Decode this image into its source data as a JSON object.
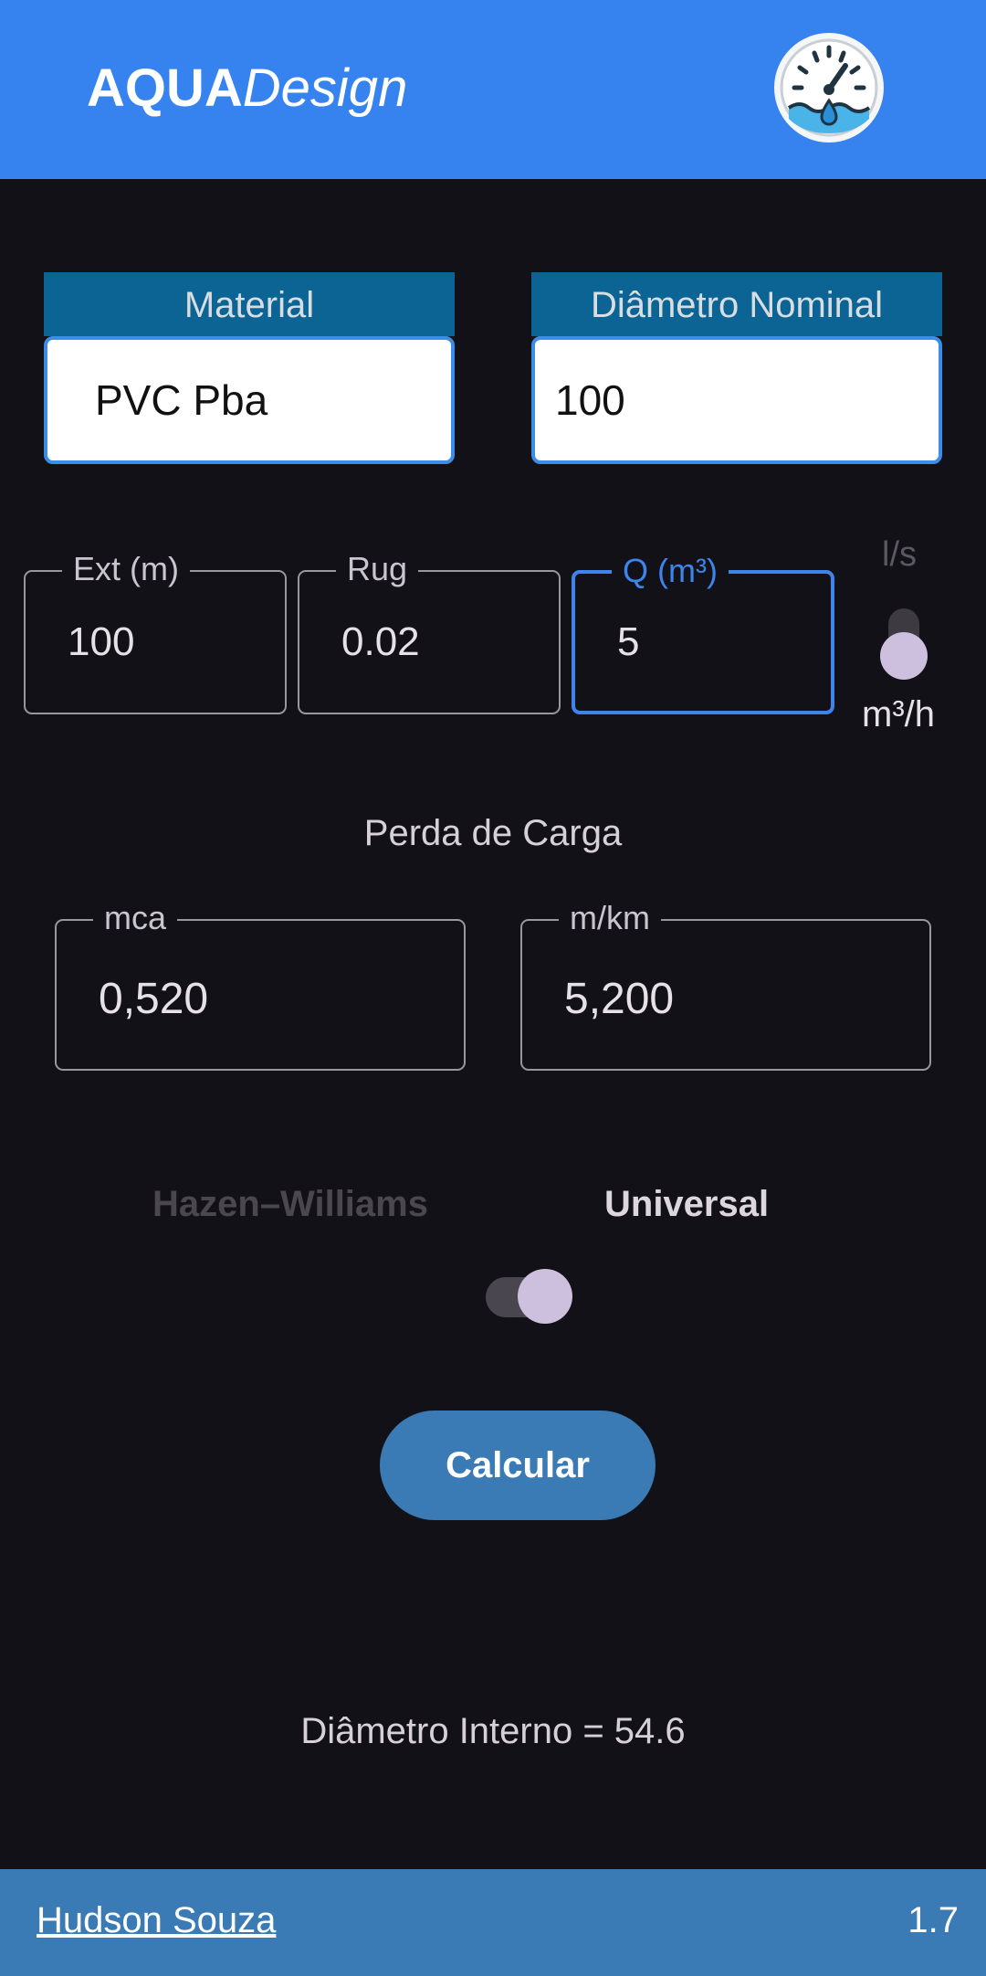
{
  "app": {
    "title_bold": "AQUA",
    "title_italic": "Design",
    "logo_icon": "pressure-gauge-water-drop-icon"
  },
  "selectors": {
    "material": {
      "label": "Material",
      "value": "PVC Pba"
    },
    "diameter": {
      "label": "Diâmetro Nominal",
      "value": "100"
    }
  },
  "inputs": {
    "ext": {
      "label": "Ext (m)",
      "value": "100"
    },
    "rug": {
      "label": "Rug",
      "value": "0.02"
    },
    "q": {
      "label": "Q (m³)",
      "value": "5"
    }
  },
  "flow_unit_toggle": {
    "top_label": "l/s",
    "bottom_label": "m³/h",
    "selected": "m³/h"
  },
  "head_loss": {
    "title": "Perda de Carga",
    "mca": {
      "label": "mca",
      "value": "0,520"
    },
    "mkm": {
      "label": "m/km",
      "value": "5,200"
    }
  },
  "method_toggle": {
    "left_label": "Hazen–Williams",
    "right_label": "Universal",
    "selected": "Universal"
  },
  "calculate_button": {
    "label": "Calcular"
  },
  "result": {
    "text": "Diâmetro Interno = 54.6"
  },
  "footer": {
    "author": "Hudson Souza",
    "version": "1.7"
  },
  "colors": {
    "appbar": "#3683ef",
    "background": "#131118",
    "accent": "#3d85ea",
    "button": "#3a7ab5",
    "label_bg": "#0b6494"
  }
}
